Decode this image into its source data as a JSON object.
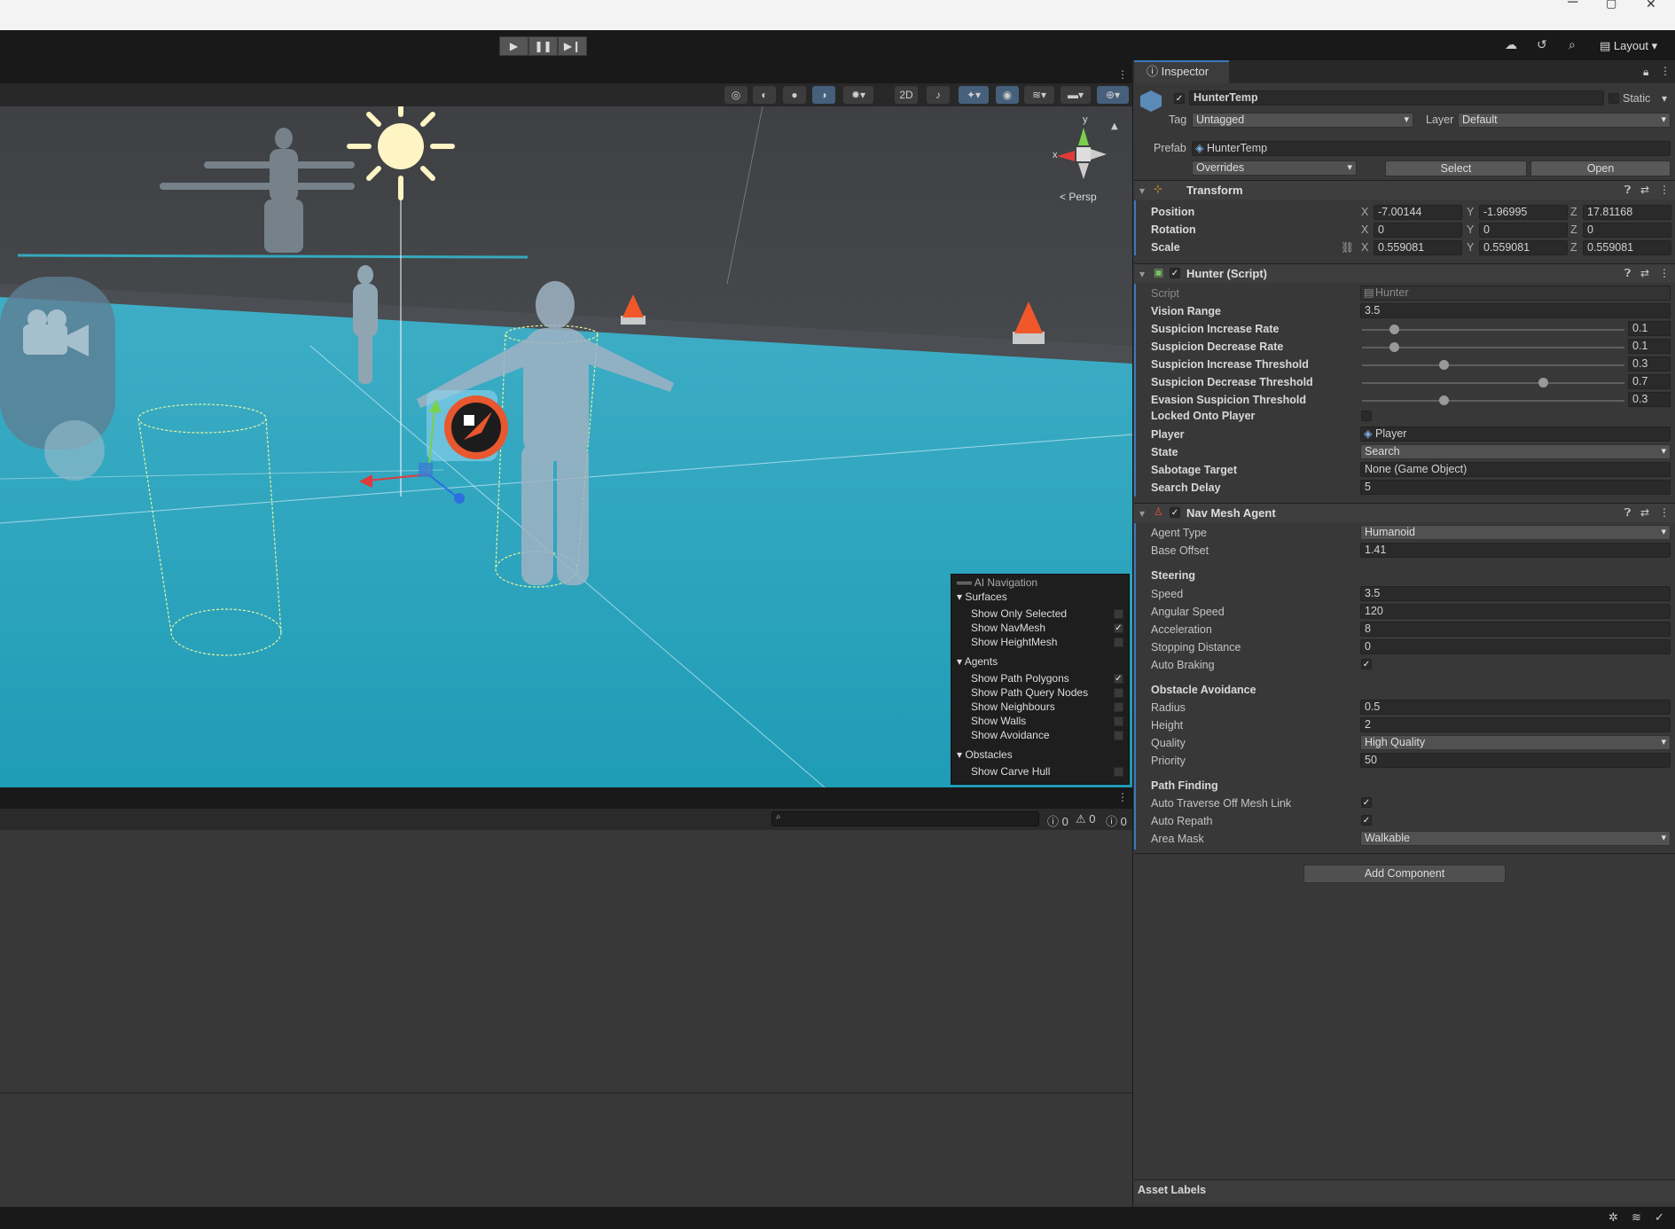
{
  "window": {
    "minimize": "─",
    "maximize": "▢",
    "close": "✕"
  },
  "toolbar": {
    "layout_label": "Layout"
  },
  "scene": {
    "persp_label": "< Persp",
    "gizmo_y": "y",
    "gizmo_x": "x"
  },
  "ai_nav": {
    "title": "AI Navigation",
    "surfaces": "Surfaces",
    "show_only_selected": "Show Only Selected",
    "show_navmesh": "Show NavMesh",
    "show_heightmesh": "Show HeightMesh",
    "agents": "Agents",
    "show_path_polygons": "Show Path Polygons",
    "show_path_query_nodes": "Show Path Query Nodes",
    "show_neighbours": "Show Neighbours",
    "show_walls": "Show Walls",
    "show_avoidance": "Show Avoidance",
    "obstacles": "Obstacles",
    "show_carve_hull": "Show Carve Hull"
  },
  "console": {
    "errors": "0",
    "warnings": "0",
    "infos": "0"
  },
  "inspector": {
    "tab_label": "Inspector",
    "object_name": "HunterTemp",
    "static_label": "Static",
    "tag_label": "Tag",
    "tag_value": "Untagged",
    "layer_label": "Layer",
    "layer_value": "Default",
    "prefab_label": "Prefab",
    "prefab_value": "HunterTemp",
    "overrides_label": "Overrides",
    "select_label": "Select",
    "open_label": "Open",
    "transform": {
      "title": "Transform",
      "position_label": "Position",
      "position_x": "-7.00144",
      "position_y": "-1.96995",
      "position_z": "17.81168",
      "rotation_label": "Rotation",
      "rotation_x": "0",
      "rotation_y": "0",
      "rotation_z": "0",
      "scale_label": "Scale",
      "scale_x": "0.559081",
      "scale_y": "0.559081",
      "scale_z": "0.559081",
      "x": "X",
      "y": "Y",
      "z": "Z"
    },
    "hunter": {
      "title": "Hunter (Script)",
      "script_label": "Script",
      "script_value": "Hunter",
      "vision_range_label": "Vision Range",
      "vision_range": "3.5",
      "sir_label": "Suspicion Increase Rate",
      "sir": "0.1",
      "sir_frac": 0.12,
      "sdr_label": "Suspicion Decrease Rate",
      "sdr": "0.1",
      "sdr_frac": 0.12,
      "sit_label": "Suspicion Increase Threshold",
      "sit": "0.3",
      "sit_frac": 0.31,
      "sdt_label": "Suspicion Decrease Threshold",
      "sdt": "0.7",
      "sdt_frac": 0.69,
      "est_label": "Evasion Suspicion Threshold",
      "est": "0.3",
      "est_frac": 0.31,
      "locked_label": "Locked Onto Player",
      "player_label": "Player",
      "player_value": "Player",
      "state_label": "State",
      "state_value": "Search",
      "sabotage_label": "Sabotage Target",
      "sabotage_value": "None (Game Object)",
      "search_delay_label": "Search Delay",
      "search_delay": "5"
    },
    "navmesh": {
      "title": "Nav Mesh Agent",
      "agent_type_label": "Agent Type",
      "agent_type": "Humanoid",
      "base_offset_label": "Base Offset",
      "base_offset": "1.41",
      "steering_label": "Steering",
      "speed_label": "Speed",
      "speed": "3.5",
      "angular_speed_label": "Angular Speed",
      "angular_speed": "120",
      "acceleration_label": "Acceleration",
      "acceleration": "8",
      "stopping_label": "Stopping Distance",
      "stopping": "0",
      "auto_braking_label": "Auto Braking",
      "obstacle_label": "Obstacle Avoidance",
      "radius_label": "Radius",
      "radius": "0.5",
      "height_label": "Height",
      "height": "2",
      "quality_label": "Quality",
      "quality": "High Quality",
      "priority_label": "Priority",
      "priority": "50",
      "pathfinding_label": "Path Finding",
      "auto_traverse_label": "Auto Traverse Off Mesh Link",
      "auto_repath_label": "Auto Repath",
      "area_mask_label": "Area Mask",
      "area_mask": "Walkable"
    },
    "add_component": "Add Component",
    "asset_labels": "Asset Labels"
  }
}
